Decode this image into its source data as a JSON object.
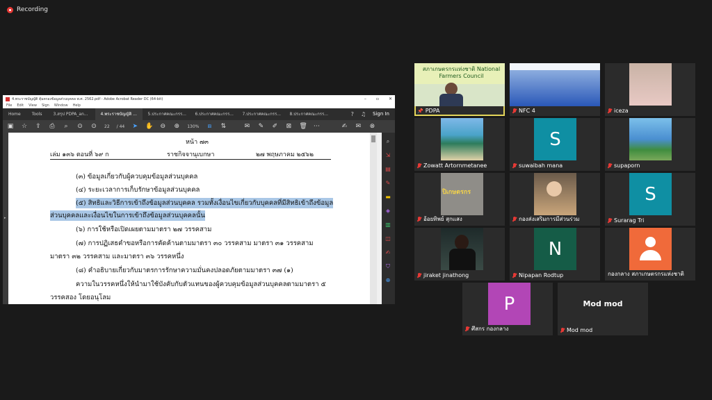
{
  "recording": {
    "label": "Recording"
  },
  "acrobat": {
    "title": "4.พระราชบัญญัติ คุ้มครองข้อมูลส่วนบุคคล พ.ศ. 2562.pdf - Adobe Acrobat Reader DC (64-bit)",
    "menu": [
      "File",
      "Edit",
      "View",
      "Sign",
      "Window",
      "Help"
    ],
    "tabs": [
      "Home",
      "Tools",
      "3.สรุป PDPA_an...",
      "4.พระราชบัญญัติ ...",
      "5.ประกาศคณะกรร...",
      "6.ประกาศคณะกรร...",
      "7.ประกาศคณะกรร...",
      "8.ประกาศคณะกรร..."
    ],
    "signin": "Sign In",
    "page_current": "22",
    "page_total": "/ 44",
    "zoom": "130%",
    "doc": {
      "page_label": "หน้า  ๗๓",
      "hdr_volume": "เล่ม   ๑๓๖   ตอนที่   ๖๙   ก",
      "hdr_gazette": "ราชกิจจานุเบกษา",
      "hdr_date": "๒๗   พฤษภาคม   ๒๕๖๒",
      "lines": [
        "(๓)  ข้อมูลเกี่ยวกับผู้ควบคุมข้อมูลส่วนบุคคล",
        "(๔)  ระยะเวลาการเก็บรักษาข้อมูลส่วนบุคคล",
        "(๕)  สิทธิและวิธีการเข้าถึงข้อมูลส่วนบุคคล  รวมทั้งเงื่อนไขเกี่ยวกับบุคคลที่มีสิทธิเข้าถึงข้อมูล",
        "ส่วนบุคคลและเงื่อนไขในการเข้าถึงข้อมูลส่วนบุคคลนั้น",
        "(๖)  การใช้หรือเปิดเผยตามมาตรา  ๒๗  วรรคสาม",
        "(๗)  การปฏิเสธคำขอหรือการคัดค้านตามมาตรา  ๓๐  วรรคสาม  มาตรา  ๓๑  วรรคสาม",
        "มาตรา  ๓๒  วรรคสาม  และมาตรา  ๓๖  วรรคหนึ่ง",
        "(๘)  คำอธิบายเกี่ยวกับมาตรการรักษาความมั่นคงปลอดภัยตามมาตรา  ๓๗  (๑)",
        "ความในวรรคหนึ่งให้นำมาใช้บังคับกับตัวแทนของผู้ควบคุมข้อมูลส่วนบุคคลตามมาตรา  ๕",
        "วรรคสอง  โดยอนุโลม"
      ]
    }
  },
  "participants": [
    {
      "name": "PDPA",
      "type": "video",
      "banner": "สภาเกษตรกรแห่งชาติ National Farmers Council",
      "active": true
    },
    {
      "name": "NFC 4",
      "type": "video"
    },
    {
      "name": "iceza",
      "type": "photo"
    },
    {
      "name": "Zowatt Artornmetanee",
      "type": "photo"
    },
    {
      "name": "suwaibah mana",
      "type": "letter",
      "letter": "S",
      "color": "#0f8fa3"
    },
    {
      "name": "supaporn",
      "type": "photo"
    },
    {
      "name": "อ้อยทิพย์ สุกแสง",
      "type": "photo",
      "overlay": "ปิเกษตรกร"
    },
    {
      "name": "กองส่งเสริมการมีส่วนร่วม",
      "type": "photo"
    },
    {
      "name": "Surarag Tri",
      "type": "letter",
      "letter": "S",
      "color": "#0f8fa3"
    },
    {
      "name": "jiraket jinathong",
      "type": "photo"
    },
    {
      "name": "Nipapan Rodtup",
      "type": "letter",
      "letter": "N",
      "color": "#155c47"
    },
    {
      "name": "กองกลาง สภาเกษตรกรแห่งชาติ",
      "type": "avatar",
      "color": "#f06a3a"
    },
    {
      "name": "ศึสกร กองกลาง",
      "type": "letter",
      "letter": "P",
      "color": "#b246b6"
    },
    {
      "name": "Mod mod",
      "type": "text",
      "display": "Mod mod"
    }
  ]
}
